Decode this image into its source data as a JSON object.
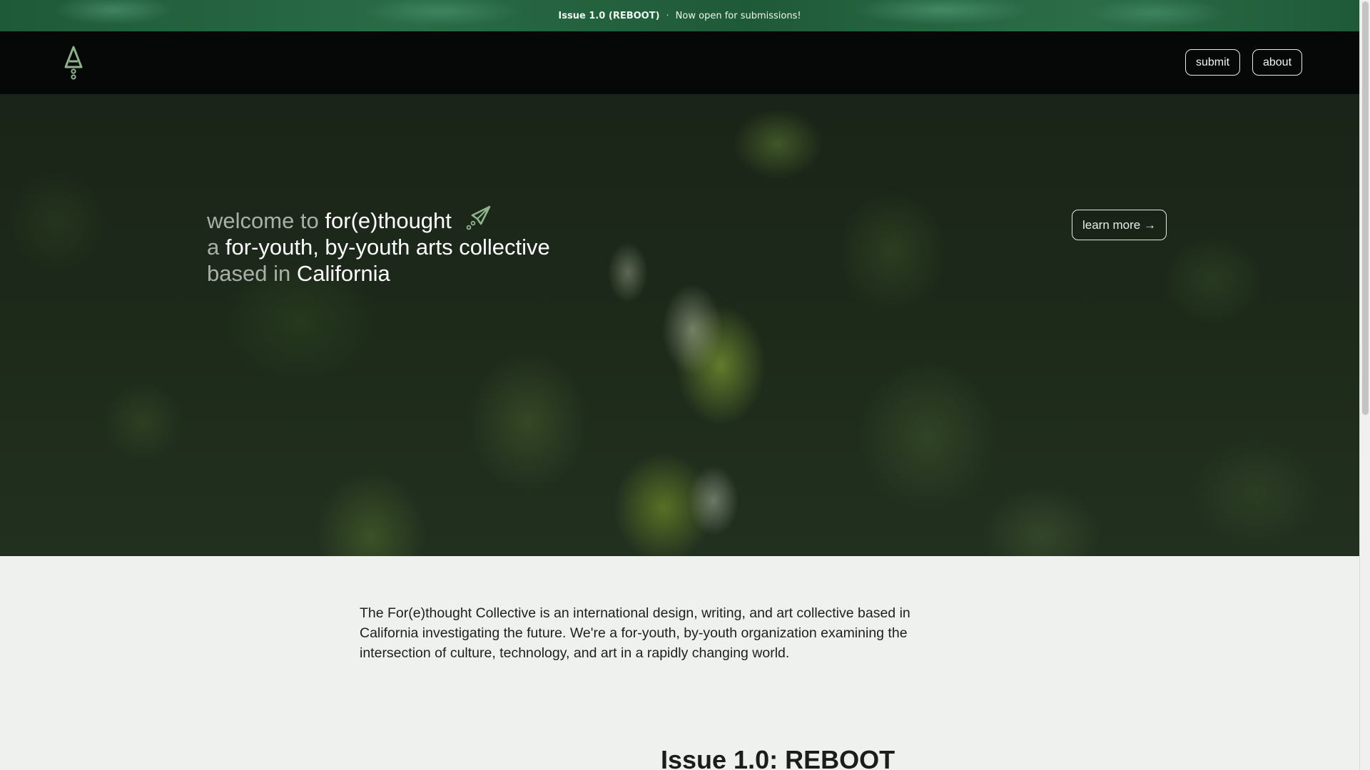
{
  "announcement": {
    "issue": "Issue 1.0 (REBOOT)",
    "separator": "·",
    "message": "Now open for submissions!"
  },
  "header": {
    "logo_icon": "rocket-a-logo-icon",
    "nav": {
      "submit_label": "submit",
      "about_label": "about"
    }
  },
  "hero": {
    "line1_muted": "welcome to ",
    "line1_strong": "for(e)thought",
    "line1_icon": "rocket-icon",
    "line2_muted": "a ",
    "line2_strong": "for-youth, by-youth arts collective",
    "line3_muted": "based in ",
    "line3_strong": "California",
    "learn_more_label": "learn more →"
  },
  "about": {
    "text": "The For(e)thought Collective is an international design, writing, and art collective based in California investigating the future. We're a for-youth, by-youth organization examining the intersection of culture, technology, and art in a rapidly changing world."
  },
  "issue_section": {
    "heading": "Issue 1.0: REBOOT"
  },
  "colors": {
    "announcement_bg": "#1f5a38",
    "header_bg": "#050806",
    "page_bg": "#eef1ee",
    "accent_logo": "#8fb48c"
  }
}
